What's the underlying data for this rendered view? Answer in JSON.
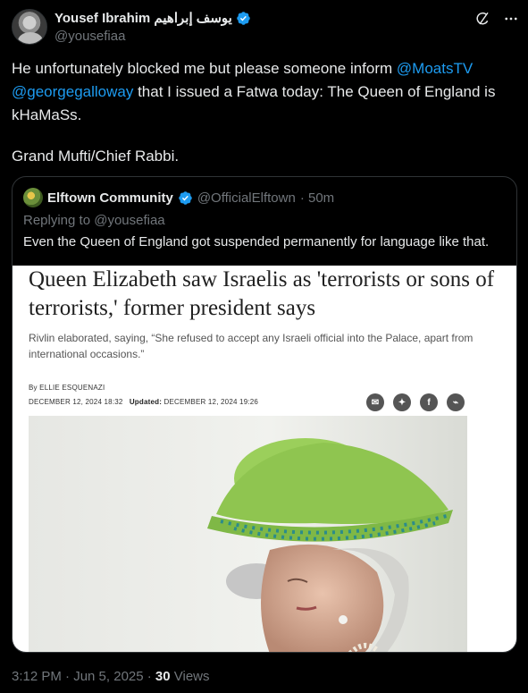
{
  "author": {
    "display_name": "Yousef Ibrahim يوسف إبراهيم",
    "handle": "@yousefiaa",
    "verified_color": "#1d9bf0"
  },
  "header_icons": [
    "grok-icon",
    "more-icon"
  ],
  "tweet": {
    "line1_prefix": "He unfortunately blocked me but please someone inform ",
    "mention1": "@MoatsTV",
    "mention2": "@georgegalloway",
    "line2_suffix": " that I issued a Fatwa today: The Queen of England is kHaMaSs.",
    "signature": "Grand Mufti/Chief Rabbi."
  },
  "quote": {
    "display_name": "Elftown Community",
    "handle": "@OfficialElftown",
    "time": "· 50m",
    "replying_to": "Replying to @yousefiaa",
    "text": "Even the Queen of England got suspended permanently for language like that.",
    "article": {
      "headline": "Queen Elizabeth saw Israelis as 'terrorists or sons of terrorists,' former president says",
      "subheadline": "Rivlin elaborated, saying, “She refused to accept any Israeli official into the Palace, apart from international occasions.”",
      "byline": "By ELLIE ESQUENAZI",
      "published": "DECEMBER 12, 2024 18:32",
      "updated_label": "Updated:",
      "updated": "DECEMBER 12, 2024 19:26",
      "share_icons": [
        "email-icon",
        "twitter-icon",
        "facebook-icon",
        "messenger-icon"
      ]
    }
  },
  "meta": {
    "time": "3:12 PM · Jun 5, 2025 · ",
    "views_count": "30",
    "views_label": " Views"
  },
  "colors": {
    "background": "#000000",
    "text": "#e7e9ea",
    "muted": "#71767b",
    "link": "#1d9bf0",
    "border": "#2f3336"
  }
}
